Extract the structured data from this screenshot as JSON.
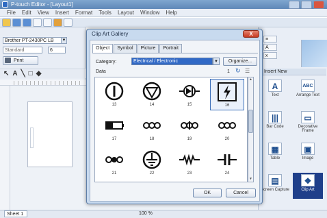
{
  "app": {
    "title": "P-touch Editor - [Layout1]",
    "menu": [
      "File",
      "Edit",
      "View",
      "Insert",
      "Format",
      "Tools",
      "Layout",
      "Window",
      "Help"
    ]
  },
  "left_panel": {
    "printer": "Brother PT-2430PC LB",
    "mode": "Standard",
    "size": "6",
    "print_label": "Print"
  },
  "status": {
    "sheet": "Sheet 1",
    "zoom": "100 %"
  },
  "right_panel": {
    "insert_header": "Insert New",
    "items": [
      {
        "label": "Text",
        "icon": "A"
      },
      {
        "label": "Arrange Text",
        "icon": "ABC"
      },
      {
        "label": "Bar Code",
        "icon": "|||"
      },
      {
        "label": "Decorative Frame",
        "icon": "▭"
      },
      {
        "label": "Table",
        "icon": "▦"
      },
      {
        "label": "Image",
        "icon": "▣"
      },
      {
        "label": "Screen Capture",
        "icon": "▤"
      },
      {
        "label": "Clip Art",
        "icon": "❖"
      }
    ],
    "selected": "Clip Art"
  },
  "dialog": {
    "title": "Clip Art Gallery",
    "close": "X",
    "tabs": [
      "Object",
      "Symbol",
      "Picture",
      "Portrait"
    ],
    "active_tab": "Object",
    "category_label": "Category:",
    "category_value": "Electrical / Electronic",
    "organize_label": "Organize...",
    "data_label": "Data",
    "page": "1",
    "symbols": [
      {
        "num": "13",
        "icon": "power-button-icon"
      },
      {
        "num": "14",
        "icon": "triangle-circle-icon"
      },
      {
        "num": "15",
        "icon": "diode-icon"
      },
      {
        "num": "16",
        "icon": "lightning-bolt-icon"
      },
      {
        "num": "17",
        "icon": "battery-icon"
      },
      {
        "num": "18",
        "icon": "triple-coil-icon"
      },
      {
        "num": "19",
        "icon": "double-coil-icon"
      },
      {
        "num": "20",
        "icon": "coil-icon"
      },
      {
        "num": "21",
        "icon": "coil-dot-icon"
      },
      {
        "num": "22",
        "icon": "ground-icon"
      },
      {
        "num": "23",
        "icon": "resistor-icon"
      },
      {
        "num": "24",
        "icon": "capacitor-icon"
      }
    ],
    "selected_symbol": "16",
    "ok_label": "OK",
    "cancel_label": "Cancel"
  }
}
